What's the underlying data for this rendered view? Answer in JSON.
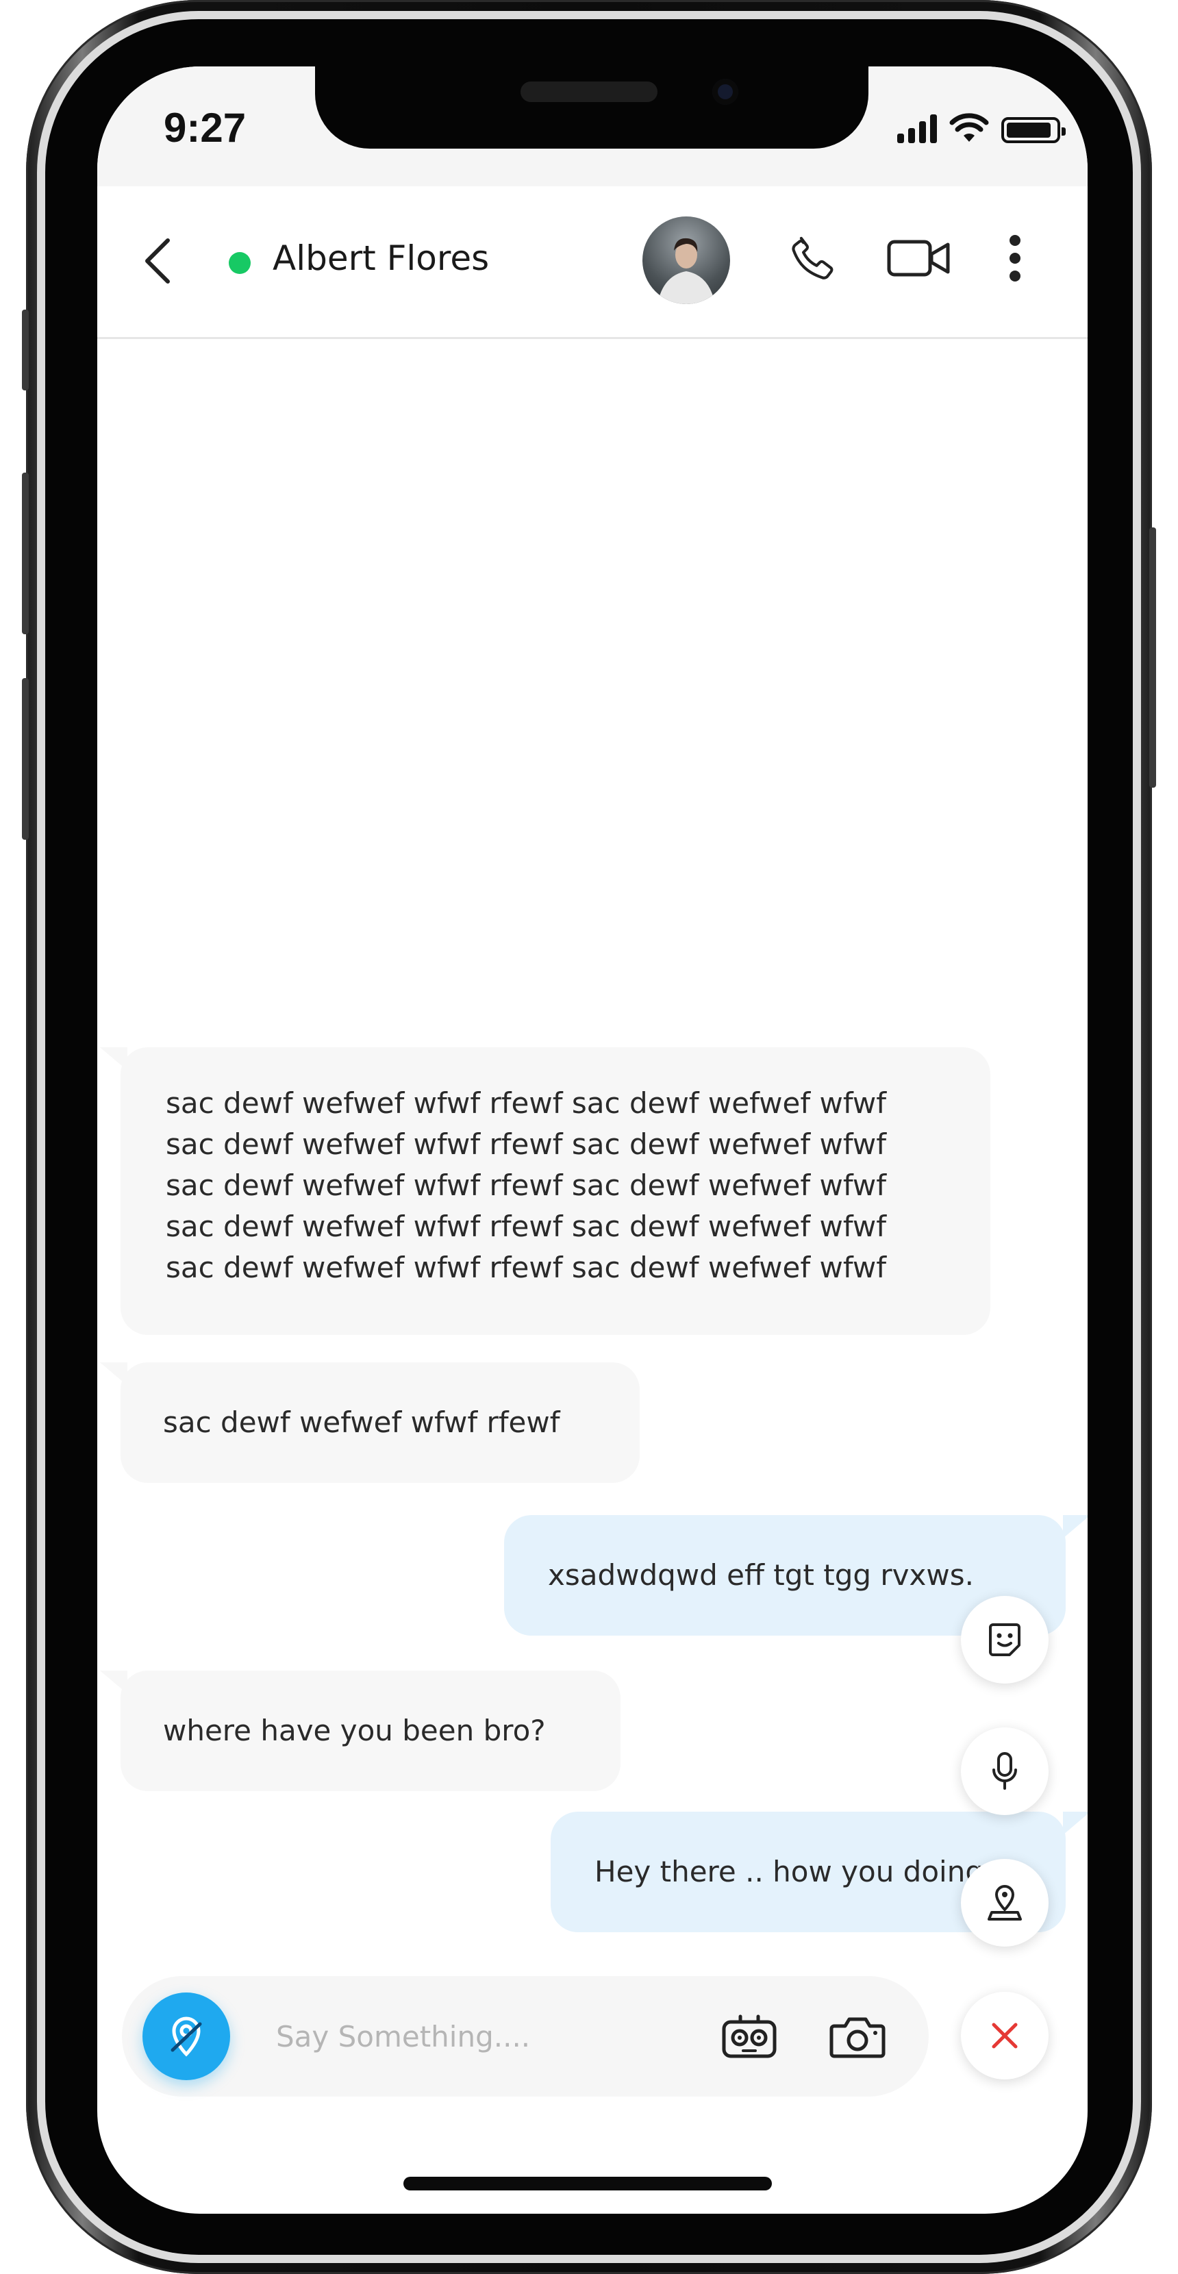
{
  "status_bar": {
    "time": "9:27"
  },
  "header": {
    "contact_name": "Albert Flores",
    "online_color": "#17c964",
    "icons": [
      "back-arrow-icon",
      "avatar",
      "phone-icon",
      "video-camera-icon",
      "more-vertical-icon"
    ]
  },
  "messages": [
    {
      "direction": "incoming",
      "lines": [
        "sac dewf wefwef wfwf rfewf sac dewf wefwef wfwf",
        "sac dewf wefwef wfwf rfewf sac dewf wefwef wfwf",
        "sac dewf wefwef wfwf rfewf sac dewf wefwef wfwf",
        "sac dewf wefwef wfwf rfewf sac dewf wefwef wfwf",
        "sac dewf wefwef wfwf rfewf sac dewf wefwef wfwf"
      ]
    },
    {
      "direction": "incoming",
      "text": "sac dewf wefwef wfwf rfewf"
    },
    {
      "direction": "outgoing",
      "text": "xsadwdqwd eff tgt tgg rvxws."
    },
    {
      "direction": "incoming",
      "text": "where have you been bro?"
    },
    {
      "direction": "outgoing",
      "text": "Hey there .. how you doing"
    }
  ],
  "quick_actions": [
    "sticker-icon",
    "microphone-icon",
    "location-pin-icon",
    "close-icon"
  ],
  "composer": {
    "placeholder": "Say Something....",
    "icons": [
      "location-share-icon",
      "robot-face-icon",
      "camera-icon"
    ]
  },
  "colors": {
    "accent": "#1fa9ef",
    "outgoing_bubble": "#e4f2fc",
    "incoming_bubble": "#f7f7f7",
    "close": "#e53935"
  }
}
